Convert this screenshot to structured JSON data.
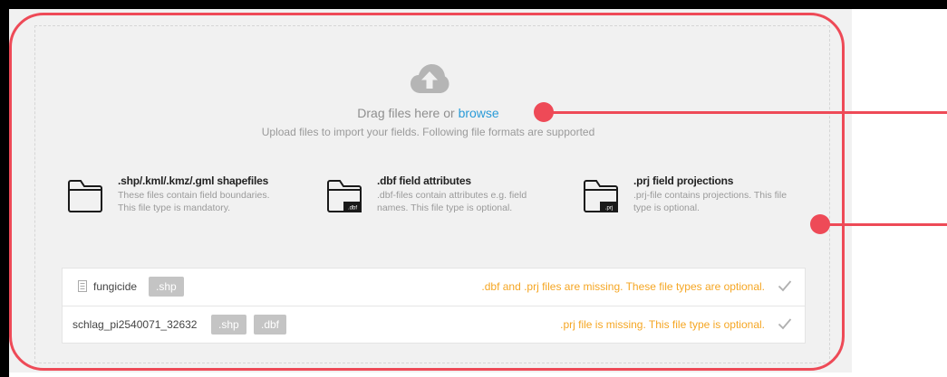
{
  "dropzone": {
    "drag_text": "Drag files here or ",
    "browse_link": "browse",
    "subtitle": "Upload files to import your fields. Following file formats are supported"
  },
  "file_types": [
    {
      "title": ".shp/.kml/.kmz/.gml shapefiles",
      "desc_line1": "These files contain field boundaries.",
      "desc_line2": "This file type is mandatory.",
      "badge": ""
    },
    {
      "title": ".dbf field attributes",
      "desc_line1": ".dbf-files contain attributes e.g. field",
      "desc_line2": "names. This file type is optional.",
      "badge": ".dbf"
    },
    {
      "title": ".prj field projections",
      "desc_line1": ".prj-file contains projections. This file",
      "desc_line2": "type is optional.",
      "badge": ".prj"
    }
  ],
  "files": [
    {
      "name": "fungicide",
      "tags": [
        ".shp"
      ],
      "message": ".dbf and .prj files are missing. These file types are optional."
    },
    {
      "name": "schlag_pi2540071_32632",
      "tags": [
        ".shp",
        ".dbf"
      ],
      "message": ".prj file is missing. This file type is optional."
    }
  ],
  "icons": {
    "upload": "cloud-upload-icon",
    "folder": "folder-icon",
    "document": "document-icon",
    "check": "check-icon"
  },
  "colors": {
    "link": "#2b9bd8",
    "warning": "#f5a623",
    "tag": "#c4c4c4",
    "annotation": "#ee4a57"
  }
}
